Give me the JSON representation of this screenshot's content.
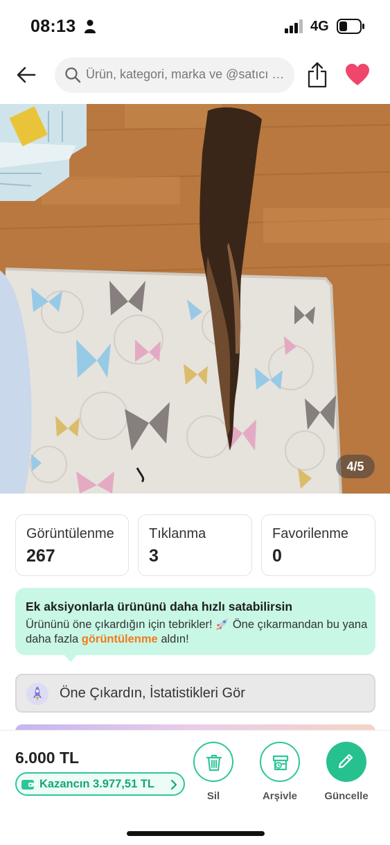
{
  "status_bar": {
    "time": "08:13",
    "network": "4G"
  },
  "nav": {
    "search_placeholder": "Ürün, kategori, marka ve @satıcı ara",
    "back_icon": "arrow-left-icon",
    "share_icon": "share-icon",
    "favorite_icon": "heart-icon",
    "favorite_color": "#f0466b"
  },
  "product": {
    "image_counter": "4/5"
  },
  "stats": [
    {
      "label": "Görüntülenme",
      "value": "267"
    },
    {
      "label": "Tıklanma",
      "value": "3"
    },
    {
      "label": "Favorilenme",
      "value": "0"
    }
  ],
  "promo": {
    "title": "Ek aksiyonlarla ürününü daha hızlı satabilirsin",
    "text_part1": "Ürününü öne çıkardığın için tebrikler! ",
    "text_part2": " Öne çıkarmandan bu yana daha fazla ",
    "highlight": "görüntülenme",
    "text_part3": " aldın!",
    "background": "#c8f7e6",
    "highlight_color": "#f27a1a"
  },
  "featured": {
    "label": "Öne Çıkardın, İstatistikleri Gör"
  },
  "bottom": {
    "price": "6.000 TL",
    "earnings": "Kazancın 3.977,51 TL",
    "actions": [
      {
        "label": "Sil",
        "icon": "trash-icon"
      },
      {
        "label": "Arşivle",
        "icon": "archive-icon"
      },
      {
        "label": "Güncelle",
        "icon": "pencil-icon"
      }
    ],
    "accent": "#26c18f"
  }
}
